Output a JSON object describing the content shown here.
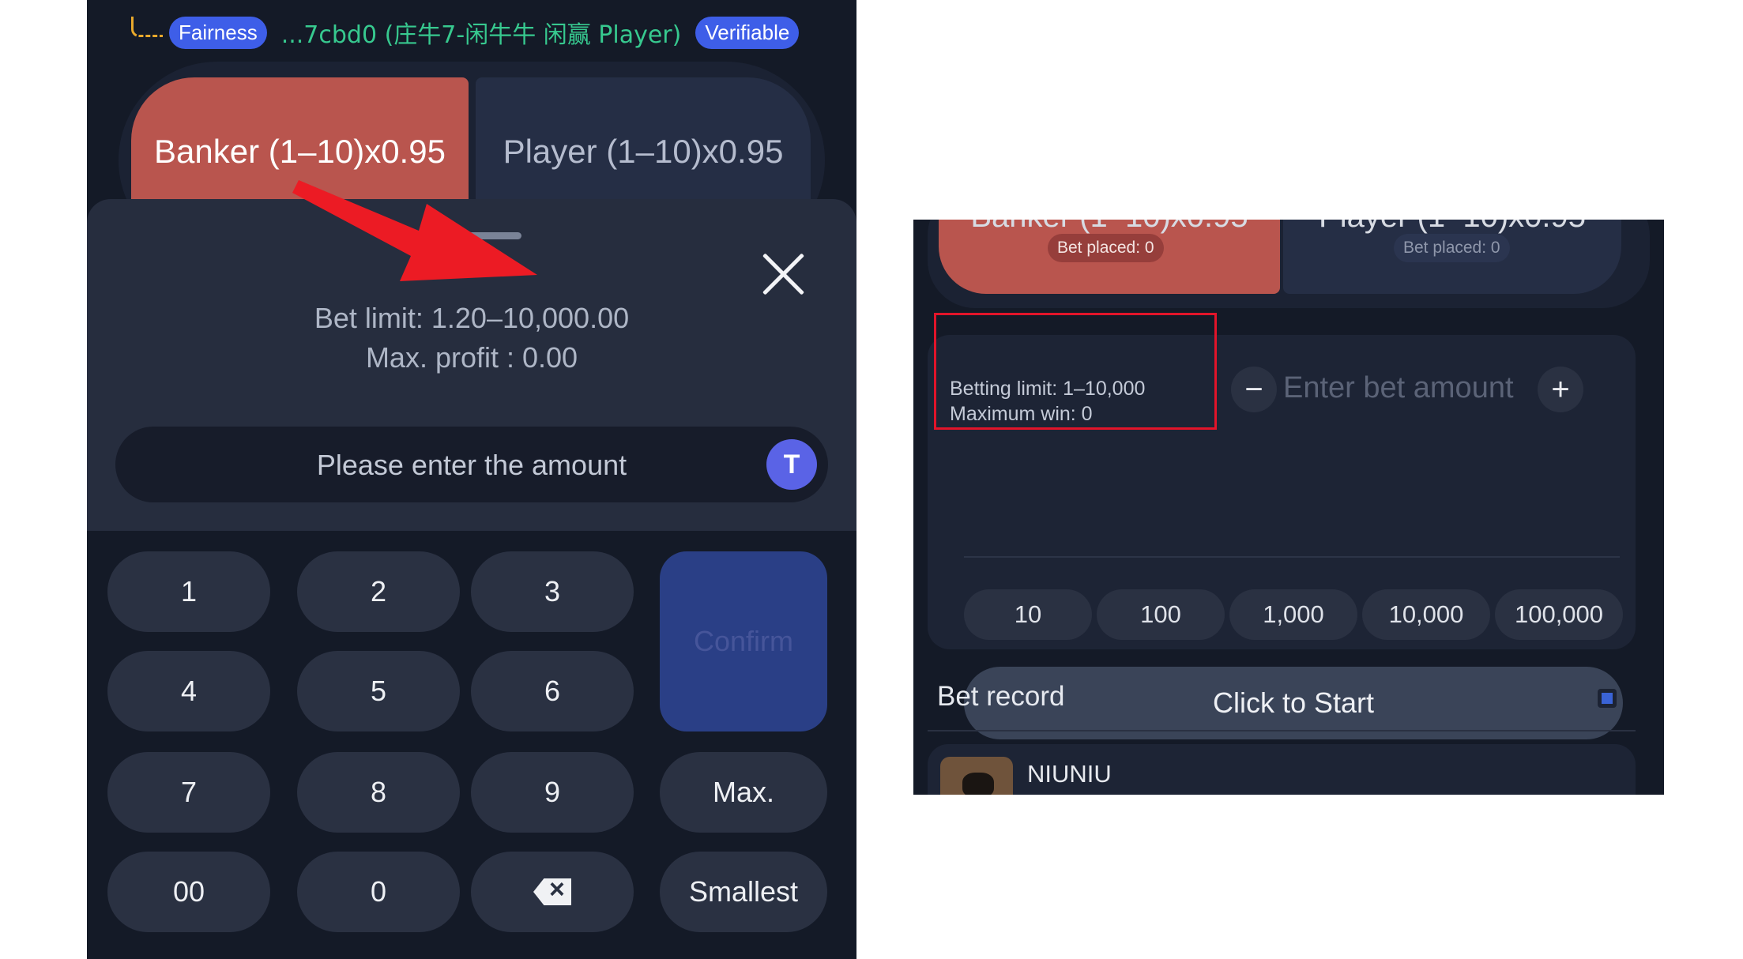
{
  "left": {
    "fairness_badge": "Fairness",
    "fairness_text": "...7cbd0 (庄牛7-闲牛牛 闲赢 Player)",
    "verifiable_badge": "Verifiable",
    "banker_label": "Banker (1–10)x0.95",
    "player_label": "Player (1–10)x0.95",
    "bet_limit": "Bet limit: 1.20–10,000.00",
    "max_profit": "Max. profit : 0.00",
    "amount_placeholder": "Please enter the amount",
    "coin_glyph": "T",
    "keys": {
      "k1": "1",
      "k2": "2",
      "k3": "3",
      "k4": "4",
      "k5": "5",
      "k6": "6",
      "k7": "7",
      "k8": "8",
      "k9": "9",
      "k00": "00",
      "k0": "0"
    },
    "confirm": "Confirm",
    "max": "Max.",
    "smallest": "Smallest"
  },
  "right": {
    "banker_cut": "Banker (1–10)x0.95",
    "player_cut": "Player (1–10)x0.95",
    "banker_placed": "Bet placed: 0",
    "player_placed": "Bet placed: 0",
    "betting_limit": "Betting limit: 1–10,000",
    "maximum_win": "Maximum win: 0",
    "minus": "−",
    "plus": "+",
    "bet_placeholder": "Enter bet amount",
    "chips": [
      "10",
      "100",
      "1,000",
      "10,000",
      "100,000"
    ],
    "start": "Click to Start",
    "bet_record": "Bet record",
    "record_item": "NIUNIU"
  },
  "colors": {
    "banker": "#b9554e",
    "player": "#252e45",
    "panel": "#141a27",
    "accent": "#3e5ee8",
    "highlight": "#e2142a"
  }
}
